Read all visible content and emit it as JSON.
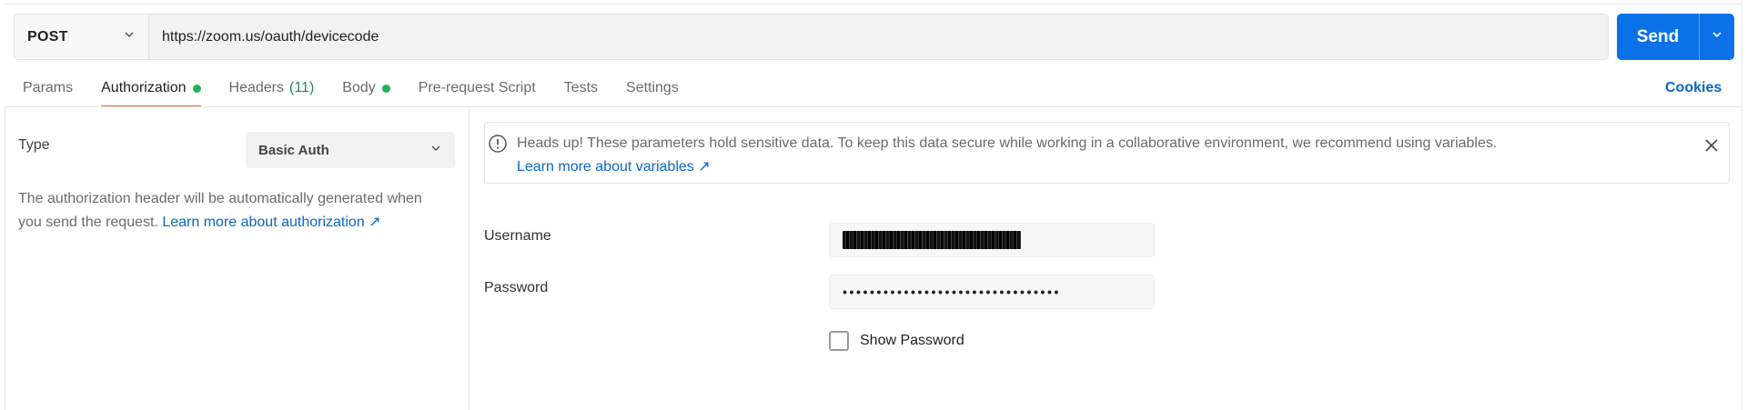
{
  "request": {
    "method": "POST",
    "url": "https://zoom.us/oauth/devicecode",
    "send_label": "Send"
  },
  "tabs": [
    {
      "label": "Params"
    },
    {
      "label": "Authorization",
      "indicator": "dot",
      "active": true
    },
    {
      "label": "Headers",
      "count": "(11)"
    },
    {
      "label": "Body",
      "indicator": "dot"
    },
    {
      "label": "Pre-request Script"
    },
    {
      "label": "Tests"
    },
    {
      "label": "Settings"
    }
  ],
  "cookies_label": "Cookies",
  "auth": {
    "type_label": "Type",
    "type_value": "Basic Auth",
    "description": "The authorization header will be automatically generated when you send the request.",
    "learn_more": "Learn more about authorization ↗"
  },
  "alert": {
    "message": "Heads up! These parameters hold sensitive data. To keep this data secure while working in a collaborative environment, we recommend using variables.",
    "link": "Learn more about variables ↗"
  },
  "form": {
    "username_label": "Username",
    "password_label": "Password",
    "password_masked": "••••••••••••••••••••••••••••••••",
    "show_password_label": "Show Password",
    "show_password_checked": false
  },
  "colors": {
    "accent": "#0a72e6",
    "active_tab_underline": "#f26b3a",
    "status_dot": "#1fb459",
    "link": "#0b66c6"
  }
}
